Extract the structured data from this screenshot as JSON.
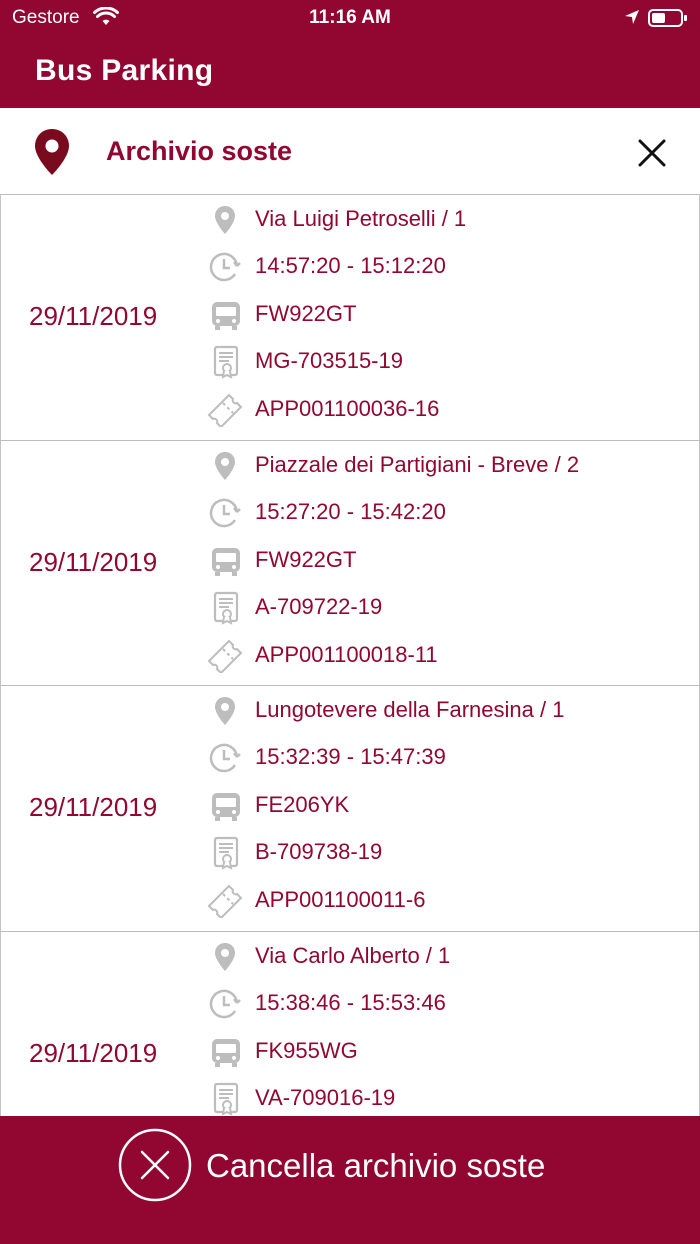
{
  "status": {
    "carrier": "Gestore",
    "time": "11:16 AM"
  },
  "app": {
    "title": "Bus Parking"
  },
  "section": {
    "title": "Archivio soste"
  },
  "records": [
    {
      "date": "29/11/2019",
      "address": "Via Luigi Petroselli / 1",
      "time": "14:57:20 - 15:12:20",
      "plate": "FW922GT",
      "permit": "MG-703515-19",
      "ticket": "APP001100036-16"
    },
    {
      "date": "29/11/2019",
      "address": "Piazzale dei Partigiani - Breve / 2",
      "time": "15:27:20 - 15:42:20",
      "plate": "FW922GT",
      "permit": "A-709722-19",
      "ticket": "APP001100018-11"
    },
    {
      "date": "29/11/2019",
      "address": "Lungotevere della Farnesina / 1",
      "time": "15:32:39 - 15:47:39",
      "plate": "FE206YK",
      "permit": "B-709738-19",
      "ticket": "APP001100011-6"
    },
    {
      "date": "29/11/2019",
      "address": "Via Carlo Alberto / 1",
      "time": "15:38:46 - 15:53:46",
      "plate": "FK955WG",
      "permit": "VA-709016-19",
      "ticket": ""
    }
  ],
  "footer": {
    "label": "Cancella archivio soste"
  },
  "colors": {
    "brand": "#920731",
    "icon_gray": "#bdbdbd"
  }
}
